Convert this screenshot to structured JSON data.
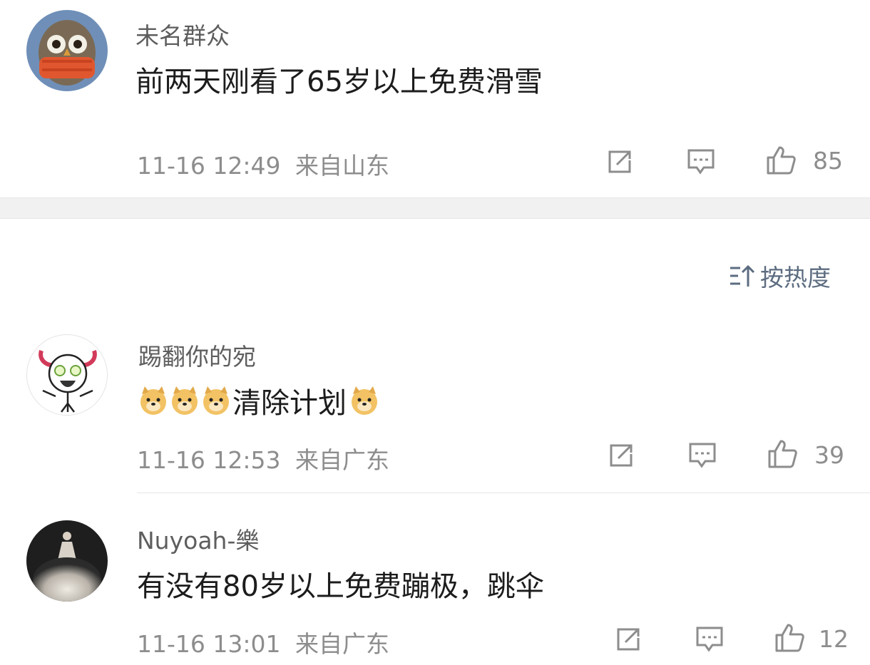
{
  "comments": [
    {
      "username": "未名群众",
      "content_text": "前两天刚看了65岁以上免费滑雪",
      "timestamp": "11-16 12:49",
      "location": "来自山东",
      "like_count": "85"
    },
    {
      "username": "踢翻你的宛",
      "content_text": "清除计划",
      "timestamp": "11-16 12:53",
      "location": "来自广东",
      "like_count": "39"
    },
    {
      "username": "Nuyoah-樂",
      "content_text": "有没有80岁以上免费蹦极，跳伞",
      "timestamp": "11-16 13:01",
      "location": "来自广东",
      "like_count": "12"
    }
  ],
  "sort": {
    "label": "按热度"
  },
  "colors": {
    "sort_accent": "#5c6c80",
    "meta": "#8d8d8d",
    "band": "#f1f1f1"
  },
  "icons": [
    "share-icon",
    "comment-icon",
    "like-icon",
    "sort-icon",
    "doge-emoji-icon"
  ]
}
